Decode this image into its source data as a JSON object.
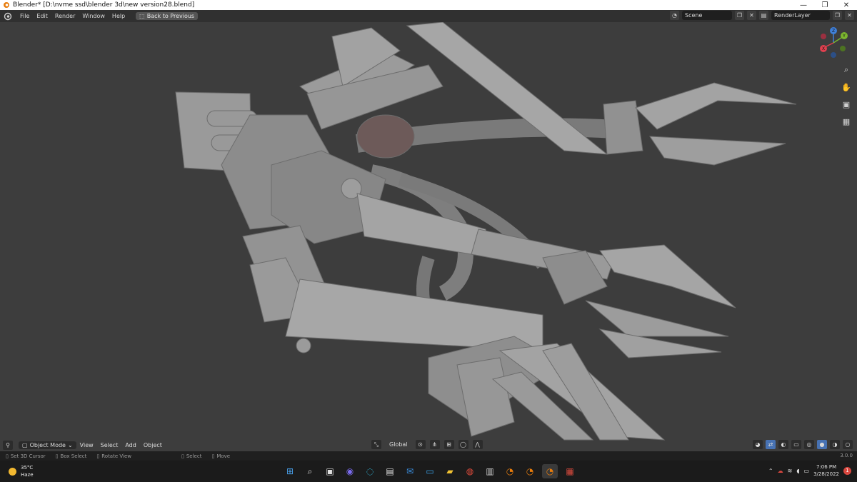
{
  "window": {
    "title": "Blender* [D:\\nvme ssd\\blender 3d\\new version28.blend]",
    "controls": [
      "—",
      "❐",
      "✕"
    ]
  },
  "menubar": {
    "items": [
      "File",
      "Edit",
      "Render",
      "Window",
      "Help"
    ],
    "back_button": "Back to Previous",
    "scene": "Scene",
    "render_layer": "RenderLayer"
  },
  "viewport_header": {
    "mode": "Object Mode",
    "menus": [
      "View",
      "Select",
      "Add",
      "Object"
    ],
    "transform_orientation": "Global"
  },
  "nav_gizmo": {
    "axes": {
      "x": "X",
      "y": "Y",
      "z": "Z"
    },
    "colors": {
      "x": "#e0404f",
      "y": "#7bb52f",
      "z": "#3f7fd9"
    }
  },
  "statusbar": {
    "hints": [
      "Set 3D Cursor",
      "Box Select",
      "Rotate View",
      "Select",
      "Move"
    ],
    "version": "3.0.0"
  },
  "taskbar": {
    "weather_temp": "35°C",
    "weather_desc": "Haze",
    "time": "7:06 PM",
    "date": "3/28/2022",
    "notification_count": "1"
  }
}
